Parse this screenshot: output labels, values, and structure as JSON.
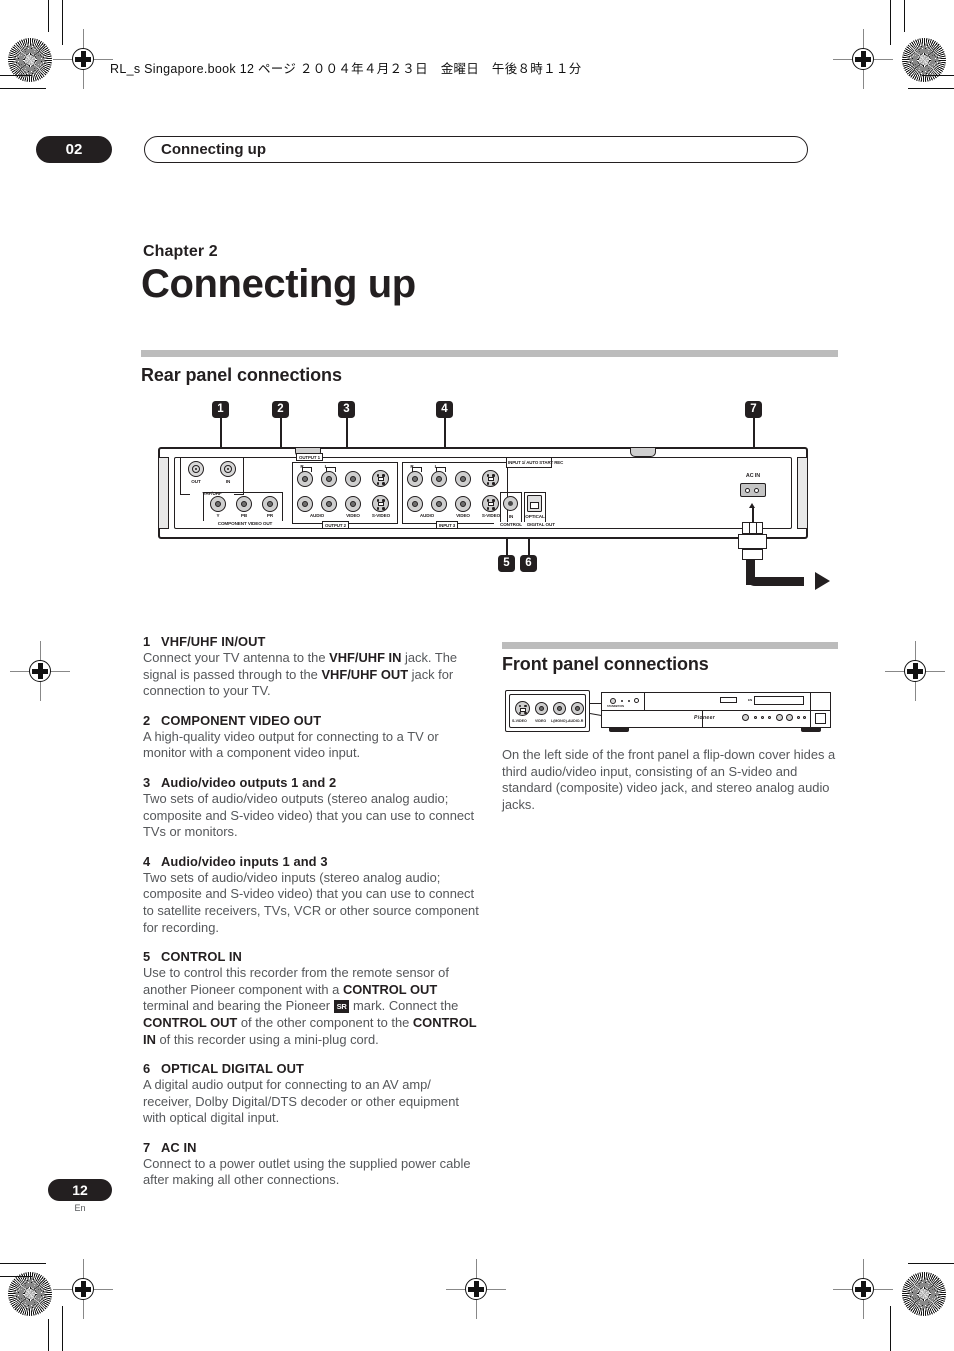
{
  "print": {
    "running_head": "RL_s Singapore.book 12 ページ ２００４年４月２３日　金曜日　午後８時１１分"
  },
  "header": {
    "chapter_number": "02",
    "running_title": "Connecting up"
  },
  "title_block": {
    "kicker": "Chapter 2",
    "title": "Connecting up"
  },
  "sections": {
    "rear": {
      "heading": "Rear panel connections"
    },
    "front": {
      "heading": "Front panel connections",
      "body": "On the left side of the front panel a flip-down cover hides a third audio/video input, consisting of an S-video and standard (composite) video jack, and stereo analog audio jacks."
    }
  },
  "callouts": [
    {
      "num": "1"
    },
    {
      "num": "2"
    },
    {
      "num": "3"
    },
    {
      "num": "4"
    },
    {
      "num": "5"
    },
    {
      "num": "6"
    },
    {
      "num": "7"
    }
  ],
  "rear_panel_labels": {
    "vhf_uhf": "VHF/UHF",
    "vhf_out": "OUT",
    "vhf_in": "IN",
    "component": "COMPONENT VIDEO OUT",
    "comp_y": "Y",
    "comp_pb": "PB",
    "comp_pr": "PR",
    "output1": "OUTPUT 1",
    "output2": "OUTPUT 2",
    "inputs": "INPUT 3",
    "input1_auto": "INPUT 1/ AUTO START REC",
    "audio": "AUDIO",
    "video": "VIDEO",
    "svideo": "S-VIDEO",
    "ch_r": "R",
    "ch_l": "L",
    "control": "CONTROL",
    "control_in": "IN",
    "optical": "OPTICAL",
    "digital_out": "DIGITAL OUT",
    "ac_in": "AC IN"
  },
  "front_panel_labels": {
    "svideo": "S-VIDEO",
    "video": "VIDEO",
    "audio": "L(MONO)-AUDIO-R",
    "brand": "Pioneer",
    "dvd": "DVD"
  },
  "items": [
    {
      "num": "1",
      "heading": "VHF/UHF IN/OUT",
      "body_html": "Connect your TV antenna to the <b>VHF/UHF IN</b> jack. The signal is passed through to the <b>VHF/UHF OUT</b> jack for connection to your TV."
    },
    {
      "num": "2",
      "heading": "COMPONENT VIDEO OUT",
      "body_html": "A high-quality video output for connecting to a TV or monitor with a component video input."
    },
    {
      "num": "3",
      "heading": "Audio/video outputs 1 and 2",
      "body_html": "Two sets of audio/video outputs (stereo analog audio; composite and S-video video) that you can use to connect TVs or monitors."
    },
    {
      "num": "4",
      "heading": "Audio/video inputs 1 and 3",
      "body_html": "Two sets of audio/video inputs (stereo analog audio; composite and S-video video) that you can use to connect to satellite receivers, TVs, VCR or other source component for recording."
    },
    {
      "num": "5",
      "heading": "CONTROL IN",
      "body_html": "Use to control this recorder from the remote sensor of another Pioneer component with a <b>CONTROL OUT</b> terminal and bearing the Pioneer <span class=\"pio-mark\">SR</span> mark. Connect the <b>CONTROL OUT</b> of the other component to the <b>CONTROL IN</b> of this recorder using a mini-plug cord."
    },
    {
      "num": "6",
      "heading": "OPTICAL DIGITAL OUT",
      "body_html": "A digital audio output for connecting to an AV amp/ receiver, Dolby Digital/DTS decoder or other equipment with optical digital input."
    },
    {
      "num": "7",
      "heading": "AC IN",
      "body_html": "Connect to a power outlet using the supplied power cable after making all other connections."
    }
  ],
  "footer": {
    "page_number": "12",
    "language": "En"
  },
  "colors": {
    "ink": "#231f20",
    "body_text": "#55575a",
    "rule": "#bcbcbc"
  }
}
